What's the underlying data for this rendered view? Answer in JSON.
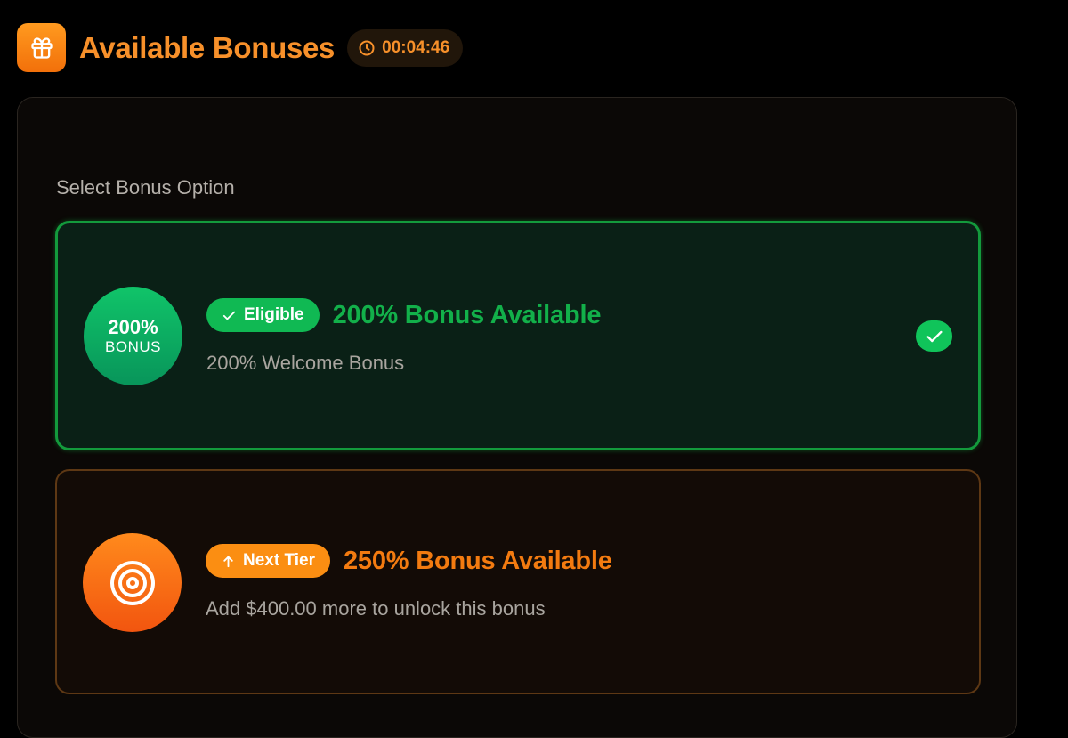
{
  "header": {
    "icon": "gift-icon",
    "title": "Available Bonuses",
    "timer": "00:04:46",
    "timer_icon": "clock-icon"
  },
  "section_label": "Select Bonus Option",
  "colors": {
    "accent_orange": "#f7902a",
    "eligible_green": "#12b04a",
    "next_tier_orange": "#f37b10"
  },
  "options": [
    {
      "badge_percent": "200%",
      "badge_word": "BONUS",
      "status": "Eligible",
      "status_icon": "check-icon",
      "title": "200% Bonus Available",
      "subtitle": "200% Welcome Bonus",
      "selected": true
    },
    {
      "badge_icon": "target-icon",
      "status": "Next Tier",
      "status_icon": "arrow-up-icon",
      "title": "250% Bonus Available",
      "subtitle": "Add $400.00 more to unlock this bonus",
      "selected": false
    }
  ]
}
